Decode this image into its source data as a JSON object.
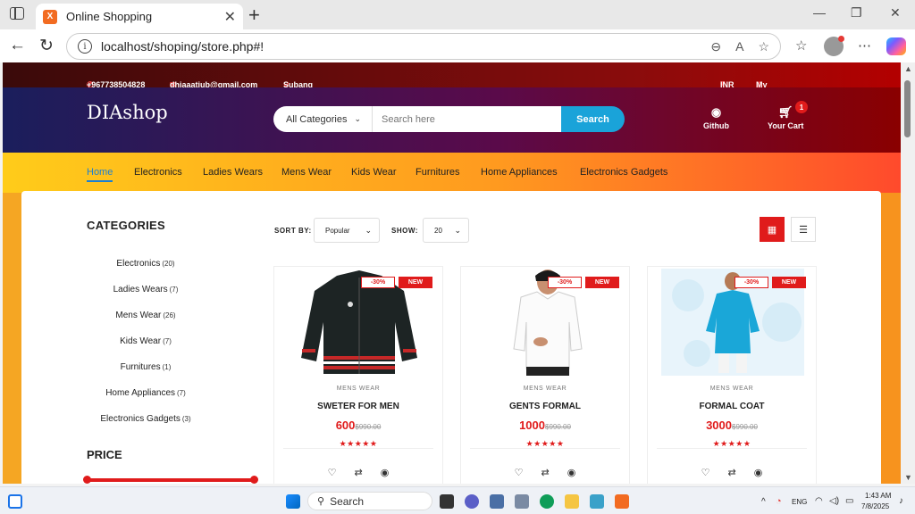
{
  "browser": {
    "tab_title": "Online Shopping",
    "tab_favicon": "X",
    "url": "localhost/shoping/store.php#!"
  },
  "topbar": {
    "phone": "+967738504828",
    "email": "dhiaaatiub@gmail.com",
    "location": "Subang",
    "currency": "INR",
    "account": "My Account"
  },
  "header": {
    "logo": "DIAshop",
    "category_select": "All Categories",
    "search_placeholder": "Search here",
    "search_button": "Search",
    "github_label": "Github",
    "cart_label": "Your Cart",
    "cart_count": "1"
  },
  "nav": {
    "items": [
      "Home",
      "Electronics",
      "Ladies Wears",
      "Mens Wear",
      "Kids Wear",
      "Furnitures",
      "Home Appliances",
      "Electronics Gadgets"
    ]
  },
  "sidebar": {
    "categories_title": "CATEGORIES",
    "categories": [
      {
        "name": "Electronics",
        "count": "(20)"
      },
      {
        "name": "Ladies Wears",
        "count": "(7)"
      },
      {
        "name": "Mens Wear",
        "count": "(26)"
      },
      {
        "name": "Kids Wear",
        "count": "(7)"
      },
      {
        "name": "Furnitures",
        "count": "(1)"
      },
      {
        "name": "Home Appliances",
        "count": "(7)"
      },
      {
        "name": "Electronics Gadgets",
        "count": "(3)"
      }
    ],
    "price_title": "PRICE"
  },
  "toolbar": {
    "sort_label": "SORT BY:",
    "sort_value": "Popular",
    "show_label": "SHOW:",
    "show_value": "20"
  },
  "products": [
    {
      "category": "MENS WEAR",
      "name": "SWETER FOR MEN",
      "price": "600",
      "old_price": "$990.00",
      "discount": "-30%",
      "tag": "NEW",
      "stars": "★★★★★"
    },
    {
      "category": "MENS WEAR",
      "name": "GENTS FORMAL",
      "price": "1000",
      "old_price": "$990.00",
      "discount": "-30%",
      "tag": "NEW",
      "stars": "★★★★★"
    },
    {
      "category": "MENS WEAR",
      "name": "FORMAL COAT",
      "price": "3000",
      "old_price": "$990.00",
      "discount": "-30%",
      "tag": "NEW",
      "stars": "★★★★★"
    }
  ],
  "taskbar": {
    "search": "Search",
    "lang": "ENG",
    "time": "1:43 AM",
    "date": "7/8/2025"
  }
}
